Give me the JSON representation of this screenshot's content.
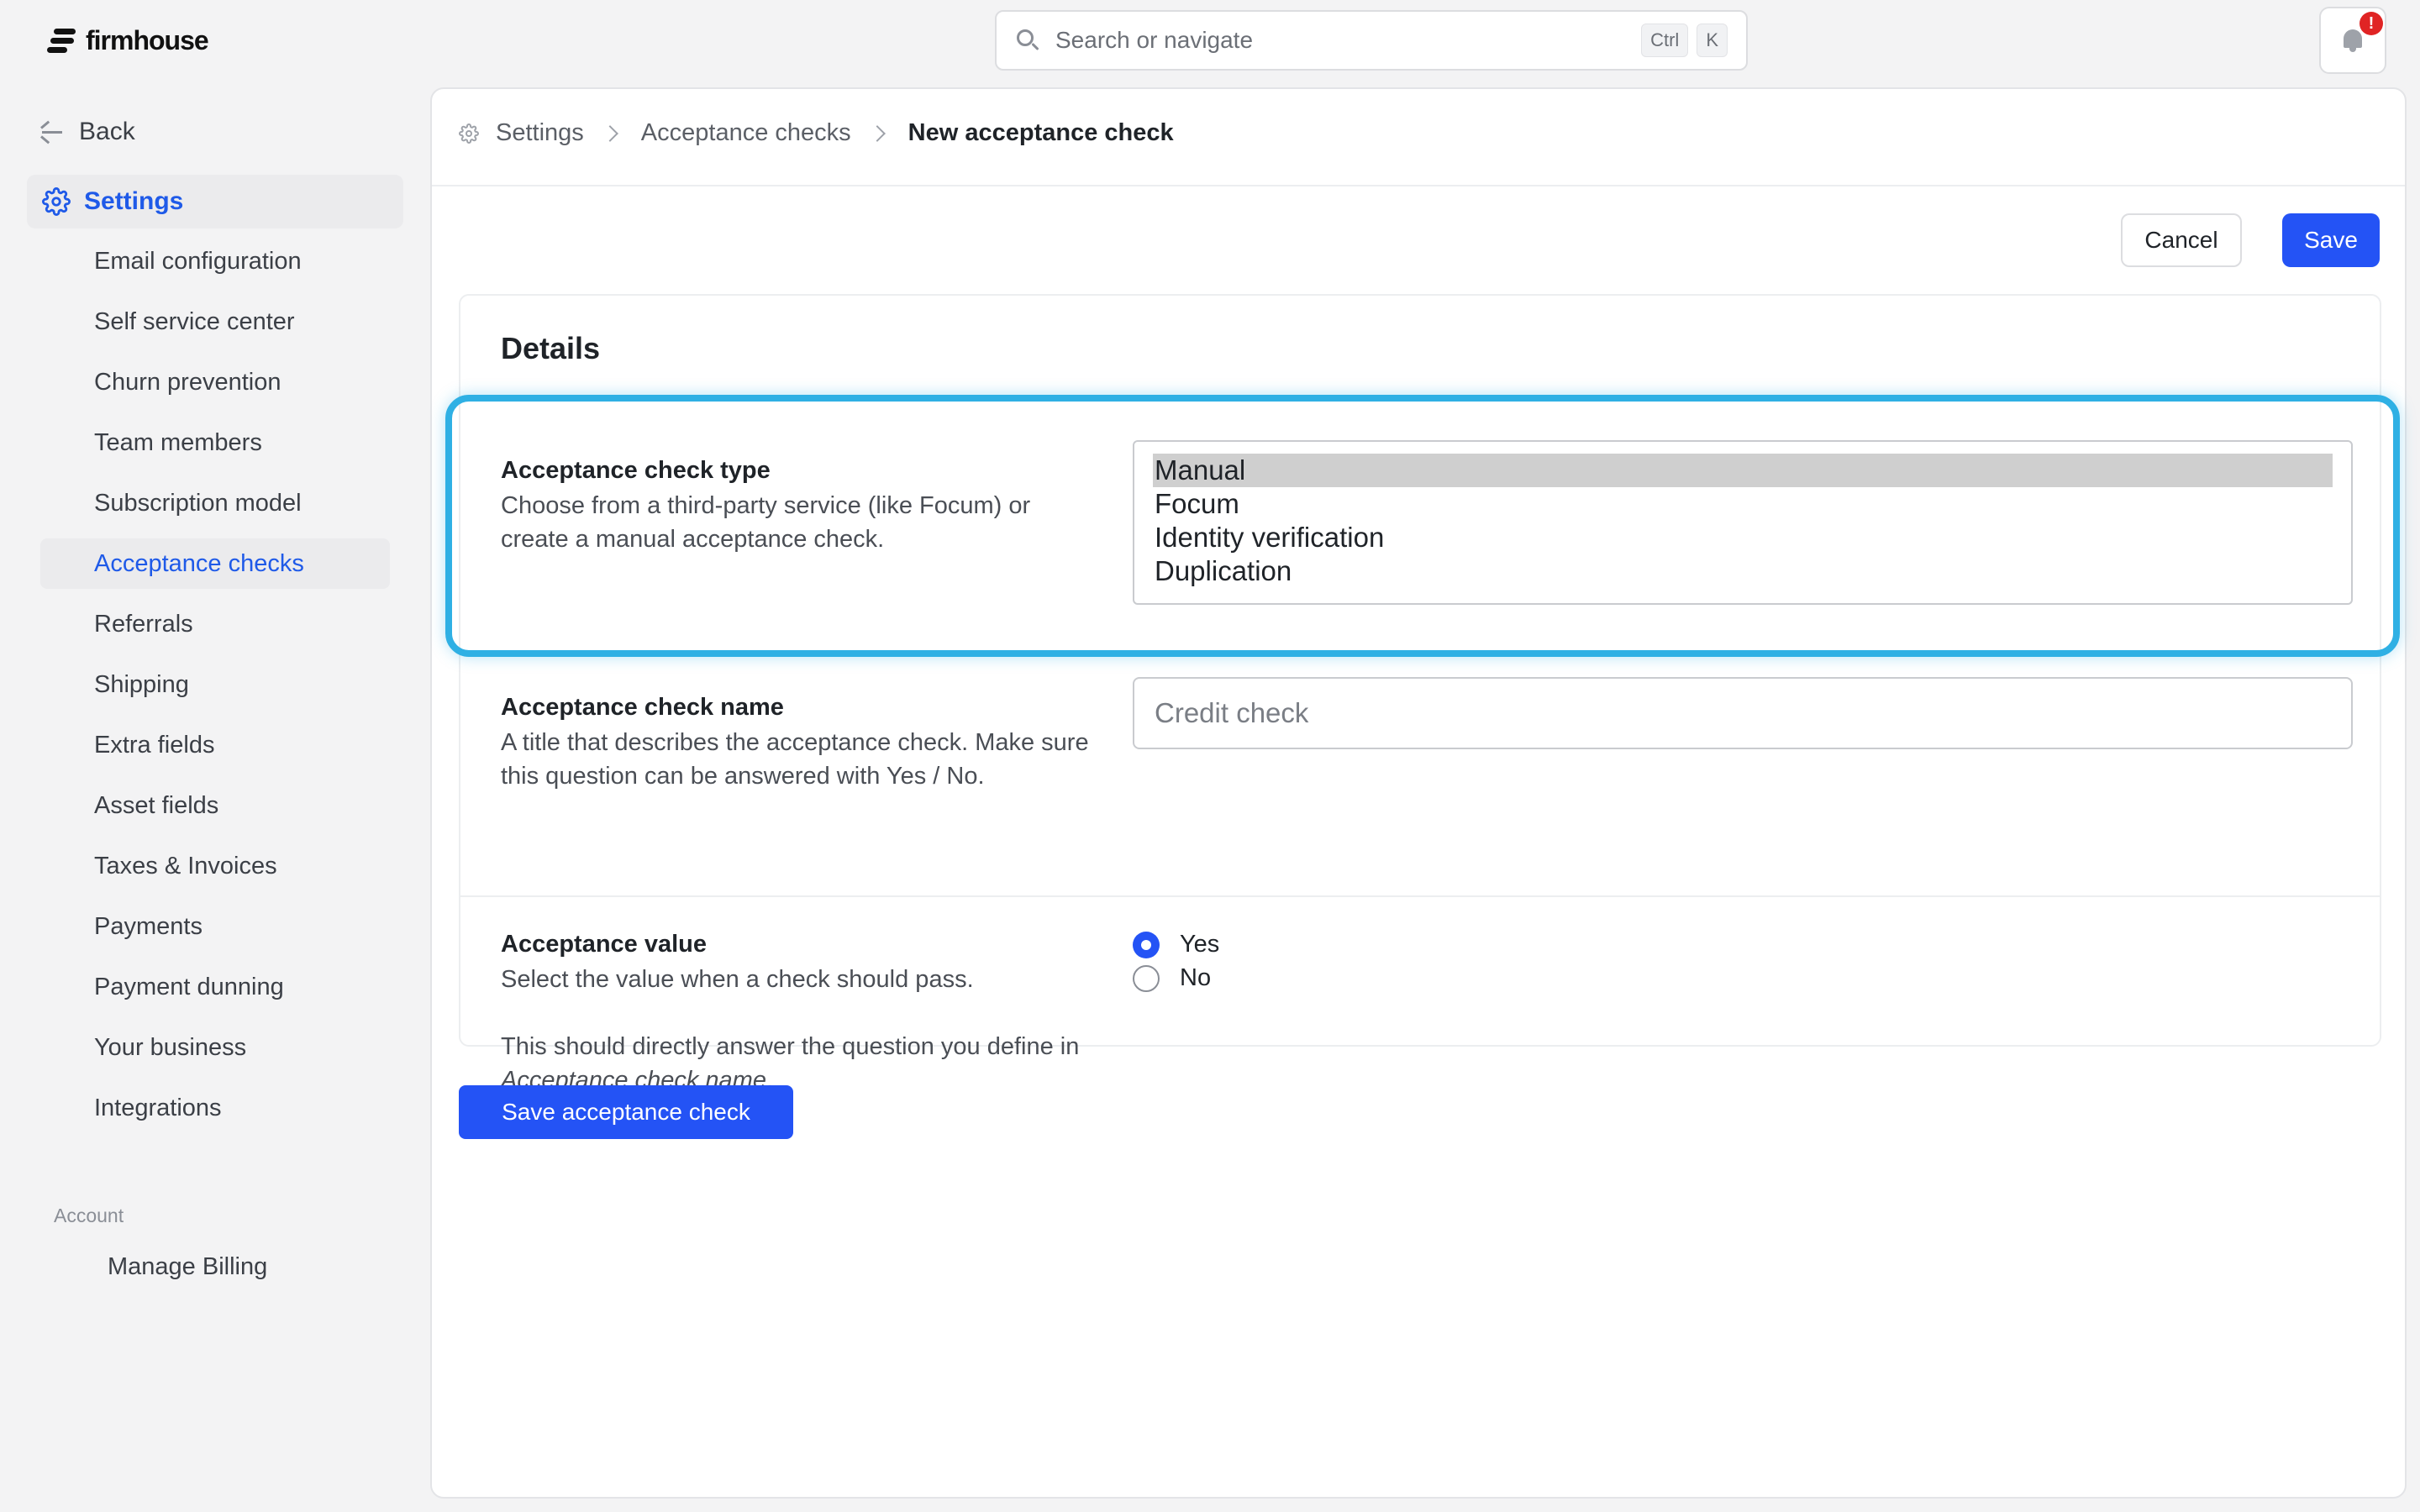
{
  "app": {
    "logo_text": "firmhouse"
  },
  "search": {
    "placeholder": "Search or navigate",
    "shortcut_mod": "Ctrl",
    "shortcut_key": "K"
  },
  "notifications": {
    "badge": "!"
  },
  "sidebar": {
    "back_label": "Back",
    "section_title": "Settings",
    "items": [
      {
        "label": "Email configuration"
      },
      {
        "label": "Self service center"
      },
      {
        "label": "Churn prevention"
      },
      {
        "label": "Team members"
      },
      {
        "label": "Subscription model"
      },
      {
        "label": "Acceptance checks"
      },
      {
        "label": "Referrals"
      },
      {
        "label": "Shipping"
      },
      {
        "label": "Extra fields"
      },
      {
        "label": "Asset fields"
      },
      {
        "label": "Taxes & Invoices"
      },
      {
        "label": "Payments"
      },
      {
        "label": "Payment dunning"
      },
      {
        "label": "Your business"
      },
      {
        "label": "Integrations"
      }
    ],
    "account_label": "Account",
    "manage_billing": "Manage Billing"
  },
  "breadcrumb": {
    "root": "Settings",
    "parent": "Acceptance checks",
    "current": "New acceptance check"
  },
  "toolbar": {
    "cancel_label": "Cancel",
    "save_label": "Save"
  },
  "details": {
    "title": "Details",
    "type": {
      "label": "Acceptance check type",
      "description": "Choose from a third-party service (like Focum) or create a manual acceptance check.",
      "options": [
        "Manual",
        "Focum",
        "Identity verification",
        "Duplication"
      ],
      "selected": "Manual"
    },
    "name": {
      "label": "Acceptance check name",
      "description": "A title that describes the acceptance check. Make sure this question can be answered with Yes / No.",
      "placeholder": "Credit check"
    },
    "value": {
      "label": "Acceptance value",
      "description": "Select the value when a check should pass.",
      "note_prefix": "This should directly answer the question you define in ",
      "note_ref": "Acceptance check name",
      "note_suffix": ".",
      "options": [
        "Yes",
        "No"
      ],
      "selected": "Yes"
    }
  },
  "footer": {
    "save_check_label": "Save acceptance check"
  },
  "colors": {
    "accent": "#2453f5",
    "highlight": "#2fb0e4"
  }
}
